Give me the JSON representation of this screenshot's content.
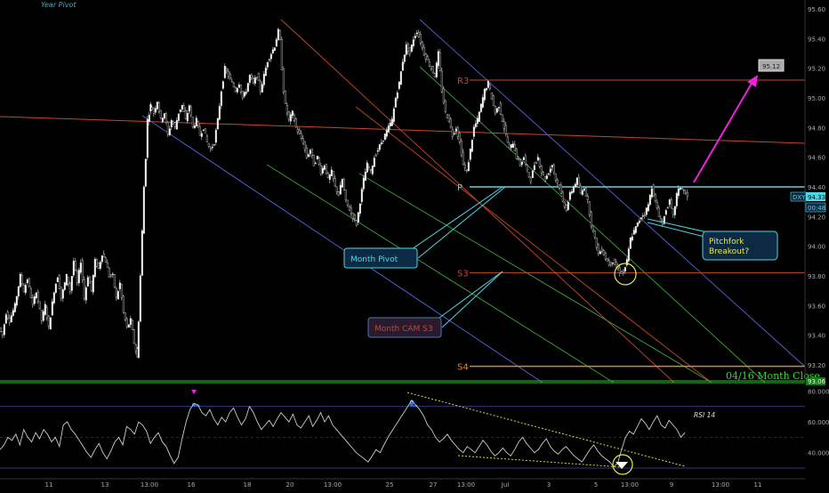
{
  "chart_data": [
    {
      "type": "candlestick",
      "symbol": "DXY",
      "current_price": "94.33",
      "secondary_price": "00:48",
      "ylim": [
        93.2,
        95.6
      ],
      "y_ticks": [
        "95.60",
        "95.40",
        "95.20",
        "95.00",
        "94.80",
        "94.60",
        "94.40",
        "94.20",
        "94.00",
        "93.80",
        "93.60",
        "93.40",
        "93.20"
      ],
      "x_ticks": [
        "11",
        "13",
        "13:00",
        "16",
        "18",
        "20",
        "13:00",
        "25",
        "27",
        "13:00",
        "Jul",
        "3",
        "5",
        "13:00",
        "9",
        "13:00",
        "11",
        "13:00",
        "16"
      ],
      "price_path": [
        [
          0,
          93.45
        ],
        [
          4,
          93.4
        ],
        [
          8,
          93.55
        ],
        [
          12,
          93.5
        ],
        [
          18,
          93.6
        ],
        [
          24,
          93.8
        ],
        [
          28,
          93.7
        ],
        [
          32,
          93.78
        ],
        [
          38,
          93.6
        ],
        [
          42,
          93.7
        ],
        [
          48,
          93.5
        ],
        [
          52,
          93.6
        ],
        [
          56,
          93.45
        ],
        [
          62,
          93.7
        ],
        [
          66,
          93.8
        ],
        [
          70,
          93.65
        ],
        [
          76,
          93.8
        ],
        [
          80,
          93.7
        ],
        [
          84,
          93.9
        ],
        [
          88,
          93.75
        ],
        [
          92,
          93.9
        ],
        [
          96,
          93.65
        ],
        [
          100,
          93.8
        ],
        [
          104,
          93.7
        ],
        [
          108,
          93.9
        ],
        [
          112,
          93.85
        ],
        [
          116,
          93.95
        ],
        [
          120,
          93.9
        ],
        [
          124,
          93.8
        ],
        [
          128,
          93.8
        ],
        [
          132,
          93.65
        ],
        [
          136,
          93.75
        ],
        [
          140,
          93.55
        ],
        [
          144,
          93.45
        ],
        [
          148,
          93.5
        ],
        [
          152,
          93.35
        ],
        [
          155,
          93.25
        ],
        [
          157,
          93.5
        ],
        [
          159,
          93.8
        ],
        [
          161,
          94.1
        ],
        [
          163,
          94.4
        ],
        [
          165,
          94.6
        ],
        [
          167,
          94.85
        ],
        [
          170,
          94.95
        ],
        [
          174,
          94.9
        ],
        [
          178,
          94.98
        ],
        [
          182,
          94.85
        ],
        [
          186,
          94.9
        ],
        [
          190,
          94.75
        ],
        [
          194,
          94.85
        ],
        [
          198,
          94.8
        ],
        [
          202,
          94.9
        ],
        [
          206,
          94.95
        ],
        [
          210,
          94.85
        ],
        [
          214,
          94.95
        ],
        [
          218,
          94.8
        ],
        [
          222,
          94.85
        ],
        [
          226,
          94.75
        ],
        [
          230,
          94.8
        ],
        [
          234,
          94.7
        ],
        [
          238,
          94.65
        ],
        [
          242,
          94.7
        ],
        [
          246,
          94.85
        ],
        [
          250,
          95.05
        ],
        [
          254,
          95.2
        ],
        [
          258,
          95.15
        ],
        [
          262,
          95.1
        ],
        [
          266,
          95.05
        ],
        [
          270,
          95.1
        ],
        [
          274,
          95.0
        ],
        [
          278,
          95.05
        ],
        [
          282,
          95.15
        ],
        [
          286,
          95.1
        ],
        [
          290,
          95.15
        ],
        [
          294,
          95.05
        ],
        [
          298,
          95.15
        ],
        [
          302,
          95.25
        ],
        [
          306,
          95.3
        ],
        [
          310,
          95.35
        ],
        [
          314,
          95.45
        ],
        [
          316,
          95.38
        ],
        [
          318,
          95.2
        ],
        [
          320,
          95.05
        ],
        [
          322,
          94.95
        ],
        [
          326,
          94.85
        ],
        [
          330,
          94.9
        ],
        [
          334,
          94.8
        ],
        [
          338,
          94.75
        ],
        [
          342,
          94.7
        ],
        [
          346,
          94.6
        ],
        [
          350,
          94.65
        ],
        [
          354,
          94.55
        ],
        [
          358,
          94.6
        ],
        [
          362,
          94.5
        ],
        [
          366,
          94.55
        ],
        [
          370,
          94.45
        ],
        [
          374,
          94.5
        ],
        [
          378,
          94.4
        ],
        [
          382,
          94.35
        ],
        [
          386,
          94.45
        ],
        [
          390,
          94.3
        ],
        [
          394,
          94.25
        ],
        [
          398,
          94.2
        ],
        [
          402,
          94.15
        ],
        [
          406,
          94.3
        ],
        [
          410,
          94.45
        ],
        [
          414,
          94.55
        ],
        [
          418,
          94.5
        ],
        [
          422,
          94.6
        ],
        [
          426,
          94.65
        ],
        [
          430,
          94.7
        ],
        [
          434,
          94.75
        ],
        [
          438,
          94.8
        ],
        [
          442,
          94.85
        ],
        [
          446,
          95.0
        ],
        [
          450,
          95.1
        ],
        [
          454,
          95.25
        ],
        [
          458,
          95.35
        ],
        [
          462,
          95.3
        ],
        [
          466,
          95.4
        ],
        [
          470,
          95.45
        ],
        [
          474,
          95.38
        ],
        [
          478,
          95.3
        ],
        [
          482,
          95.25
        ],
        [
          486,
          95.2
        ],
        [
          490,
          95.15
        ],
        [
          494,
          95.3
        ],
        [
          498,
          95.05
        ],
        [
          502,
          94.9
        ],
        [
          506,
          94.85
        ],
        [
          510,
          94.75
        ],
        [
          514,
          94.8
        ],
        [
          518,
          94.7
        ],
        [
          522,
          94.55
        ],
        [
          526,
          94.5
        ],
        [
          530,
          94.65
        ],
        [
          534,
          94.8
        ],
        [
          538,
          94.85
        ],
        [
          542,
          94.95
        ],
        [
          546,
          95.05
        ],
        [
          550,
          95.1
        ],
        [
          554,
          95.0
        ],
        [
          558,
          94.9
        ],
        [
          562,
          94.95
        ],
        [
          566,
          94.85
        ],
        [
          570,
          94.75
        ],
        [
          574,
          94.65
        ],
        [
          578,
          94.7
        ],
        [
          582,
          94.6
        ],
        [
          586,
          94.55
        ],
        [
          590,
          94.6
        ],
        [
          594,
          94.5
        ],
        [
          598,
          94.45
        ],
        [
          602,
          94.55
        ],
        [
          606,
          94.6
        ],
        [
          610,
          94.5
        ],
        [
          614,
          94.45
        ],
        [
          618,
          94.5
        ],
        [
          622,
          94.55
        ],
        [
          626,
          94.45
        ],
        [
          630,
          94.4
        ],
        [
          634,
          94.3
        ],
        [
          638,
          94.25
        ],
        [
          642,
          94.35
        ],
        [
          646,
          94.4
        ],
        [
          650,
          94.45
        ],
        [
          654,
          94.35
        ],
        [
          658,
          94.4
        ],
        [
          662,
          94.3
        ],
        [
          666,
          94.15
        ],
        [
          670,
          94.05
        ],
        [
          674,
          93.95
        ],
        [
          678,
          93.98
        ],
        [
          682,
          93.92
        ],
        [
          686,
          93.88
        ],
        [
          690,
          93.9
        ],
        [
          694,
          93.86
        ],
        [
          698,
          93.83
        ],
        [
          702,
          93.82
        ],
        [
          706,
          93.9
        ],
        [
          710,
          94.05
        ],
        [
          714,
          94.1
        ],
        [
          718,
          94.15
        ],
        [
          722,
          94.2
        ],
        [
          726,
          94.22
        ],
        [
          730,
          94.28
        ],
        [
          734,
          94.4
        ],
        [
          738,
          94.3
        ],
        [
          742,
          94.2
        ],
        [
          746,
          94.15
        ],
        [
          750,
          94.25
        ],
        [
          754,
          94.3
        ],
        [
          758,
          94.2
        ],
        [
          762,
          94.35
        ],
        [
          766,
          94.4
        ],
        [
          770,
          94.37
        ],
        [
          774,
          94.33
        ]
      ],
      "levels": [
        {
          "label": "R3",
          "value": 95.12,
          "color": "#c8462a"
        },
        {
          "label": "P",
          "value": 94.4,
          "color": "#4fd6e6"
        },
        {
          "label": "S3",
          "value": 93.82,
          "color": "#c8462a"
        },
        {
          "label": "S4",
          "value": 93.19,
          "color": "#e8822a"
        },
        {
          "label": "04/16 Month Close",
          "value": 93.06,
          "color": "#22cc22"
        }
      ],
      "target_label": "95.12",
      "close_value_label": "93.06"
    },
    {
      "type": "line",
      "title": "RSI 14",
      "y_ticks": [
        "80.0000",
        "60.0000",
        "40.0000"
      ],
      "ylim": [
        30,
        82
      ],
      "overbought": 70,
      "oversold": 30,
      "values": [
        42,
        45,
        50,
        48,
        52,
        45,
        55,
        50,
        47,
        53,
        49,
        55,
        52,
        47,
        50,
        44,
        58,
        60,
        55,
        52,
        48,
        44,
        40,
        37,
        42,
        46,
        40,
        36,
        41,
        47,
        50,
        45,
        57,
        55,
        52,
        60,
        58,
        54,
        46,
        50,
        53,
        47,
        44,
        38,
        33,
        37,
        49,
        60,
        68,
        72,
        71,
        66,
        64,
        68,
        62,
        58,
        63,
        60,
        66,
        69,
        63,
        58,
        62,
        70,
        66,
        60,
        55,
        58,
        61,
        57,
        62,
        66,
        63,
        60,
        65,
        58,
        56,
        60,
        64,
        57,
        61,
        66,
        60,
        64,
        58,
        55,
        52,
        49,
        46,
        43,
        40,
        38,
        36,
        34,
        38,
        42,
        40,
        45,
        50,
        54,
        58,
        62,
        66,
        70,
        74,
        71,
        68,
        64,
        58,
        55,
        50,
        47,
        49,
        52,
        48,
        45,
        42,
        40,
        44,
        42,
        40,
        44,
        48,
        45,
        41,
        38,
        40,
        43,
        40,
        38,
        42,
        47,
        50,
        46,
        43,
        40,
        42,
        46,
        49,
        44,
        41,
        39,
        42,
        44,
        41,
        38,
        36,
        34,
        38,
        42,
        45,
        41,
        38,
        36,
        34,
        31,
        33,
        42,
        50,
        54,
        52,
        57,
        62,
        59,
        55,
        60,
        64,
        58,
        56,
        61,
        58,
        55,
        50,
        53
      ]
    }
  ],
  "annotations": {
    "year_pivot": "Year Pivot",
    "month_pivot": "Month Pivot",
    "month_cam_s3": "Month CAM S3",
    "pitchfork_breakout_line1": "Pitchfork",
    "pitchfork_breakout_line2": "Breakout?",
    "rsi_label": "RSI 14",
    "month_close": "04/16 Month Close"
  },
  "colors": {
    "background": "#000000",
    "pitchfork_median": "#c8462a",
    "pitchfork_outer": "#5566dd",
    "pitchfork_inner": "#3aa33a",
    "pivot": "#4fd6e6",
    "arrow": "#ee22dd",
    "rsi_line": "#cccccc",
    "rsi_fill": "#2a6adf",
    "trendline": "#d9d93a"
  }
}
